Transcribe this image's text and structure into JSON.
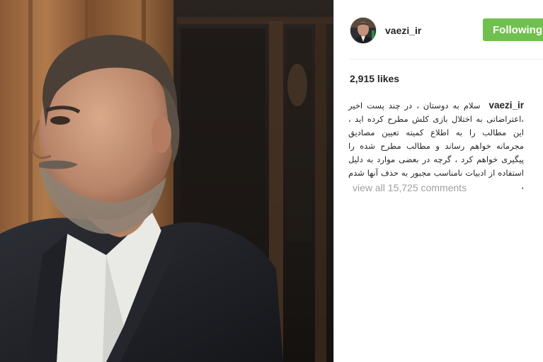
{
  "post": {
    "username": "vaezi_ir",
    "follow_button_label": "Following",
    "likes_text": "2,915 likes",
    "caption_username": "vaezi_ir",
    "caption_text": "سلام به دوستان ، در چند پست اخیر ،اعتراضاتی به اختلال بازی کلش مطرح کرده اید ، این مطالب را به اطلاع کمیته تعیین مصادیق مجرمانه خواهم رساند و مطالب مطرح شده را پیگیری خواهم کرد ، گرچه در بعضی موارد به دلیل استفاده از ادبیات نامناسب مجبور به حذف آنها شدم ،",
    "view_comments_label": "view all 15,725 comments"
  },
  "icons": {
    "avatar": "profile-photo-avatar",
    "photo": "portrait-photo"
  },
  "colors": {
    "follow_button_bg": "#70c050",
    "follow_button_text": "#ffffff",
    "text_primary": "#262626",
    "text_muted": "#a0a0a0"
  }
}
